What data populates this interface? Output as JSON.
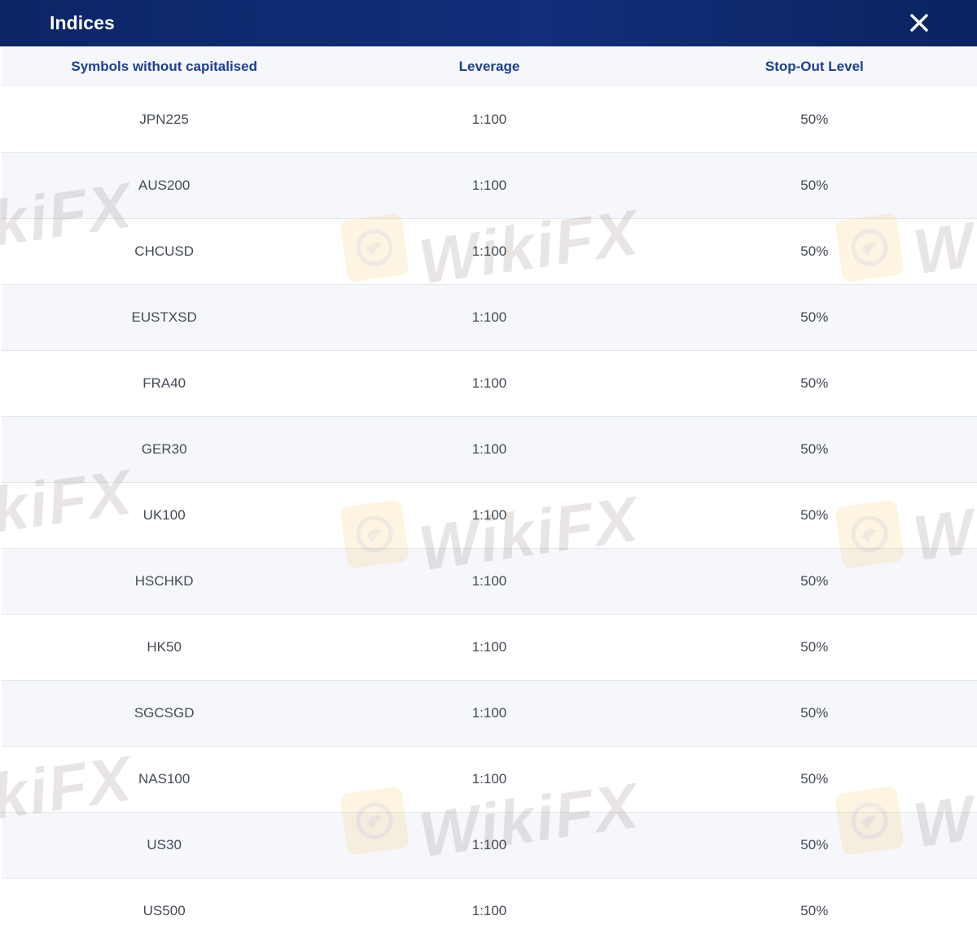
{
  "dialog": {
    "title": "Indices",
    "close_icon": "close-icon"
  },
  "table": {
    "columns": [
      "Symbols without capitalised",
      "Leverage",
      "Stop-Out Level"
    ],
    "rows": [
      {
        "symbol": "JPN225",
        "leverage": "1:100",
        "stop_out": "50%"
      },
      {
        "symbol": "AUS200",
        "leverage": "1:100",
        "stop_out": "50%"
      },
      {
        "symbol": "CHCUSD",
        "leverage": "1:100",
        "stop_out": "50%"
      },
      {
        "symbol": "EUSTXSD",
        "leverage": "1:100",
        "stop_out": "50%"
      },
      {
        "symbol": "FRA40",
        "leverage": "1:100",
        "stop_out": "50%"
      },
      {
        "symbol": "GER30",
        "leverage": "1:100",
        "stop_out": "50%"
      },
      {
        "symbol": "UK100",
        "leverage": "1:100",
        "stop_out": "50%"
      },
      {
        "symbol": "HSCHKD",
        "leverage": "1:100",
        "stop_out": "50%"
      },
      {
        "symbol": "HK50",
        "leverage": "1:100",
        "stop_out": "50%"
      },
      {
        "symbol": "SGCSGD",
        "leverage": "1:100",
        "stop_out": "50%"
      },
      {
        "symbol": "NAS100",
        "leverage": "1:100",
        "stop_out": "50%"
      },
      {
        "symbol": "US30",
        "leverage": "1:100",
        "stop_out": "50%"
      },
      {
        "symbol": "US500",
        "leverage": "1:100",
        "stop_out": "50%"
      }
    ]
  },
  "watermark": {
    "text": "WikiFX",
    "partial_left": "kiFX",
    "partial_right": "Wi",
    "logo_icon": "eagle-logo-icon",
    "color": "#f0b429"
  },
  "colors": {
    "titlebar": "#0b2566",
    "header_text": "#1c3f8f",
    "cell_text": "#444a55"
  }
}
